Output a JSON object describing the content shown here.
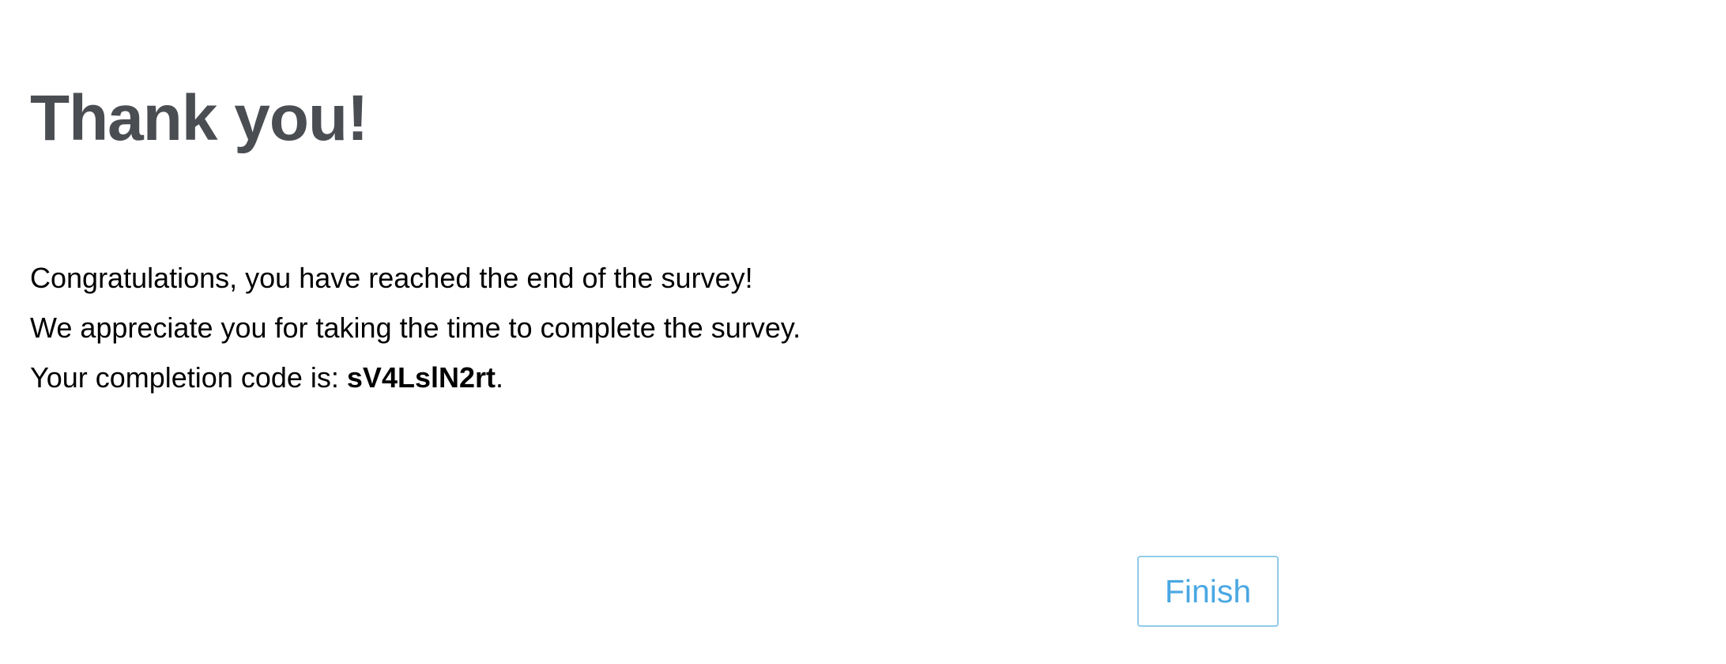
{
  "page": {
    "title": "Thank you!",
    "message": {
      "line_1": "Congratulations, you have reached the end of the survey!",
      "line_2": "We appreciate you for taking the time to complete the survey.",
      "line_3_prefix": "Your completion code is: ",
      "completion_code": "sV4LslN2rt",
      "line_3_suffix": "."
    }
  },
  "actions": {
    "finish_label": "Finish"
  },
  "colors": {
    "title_text": "#4a4d52",
    "body_text": "#000000",
    "button_border": "#8fcbe7",
    "button_text": "#4aa7e3",
    "background": "#ffffff"
  }
}
